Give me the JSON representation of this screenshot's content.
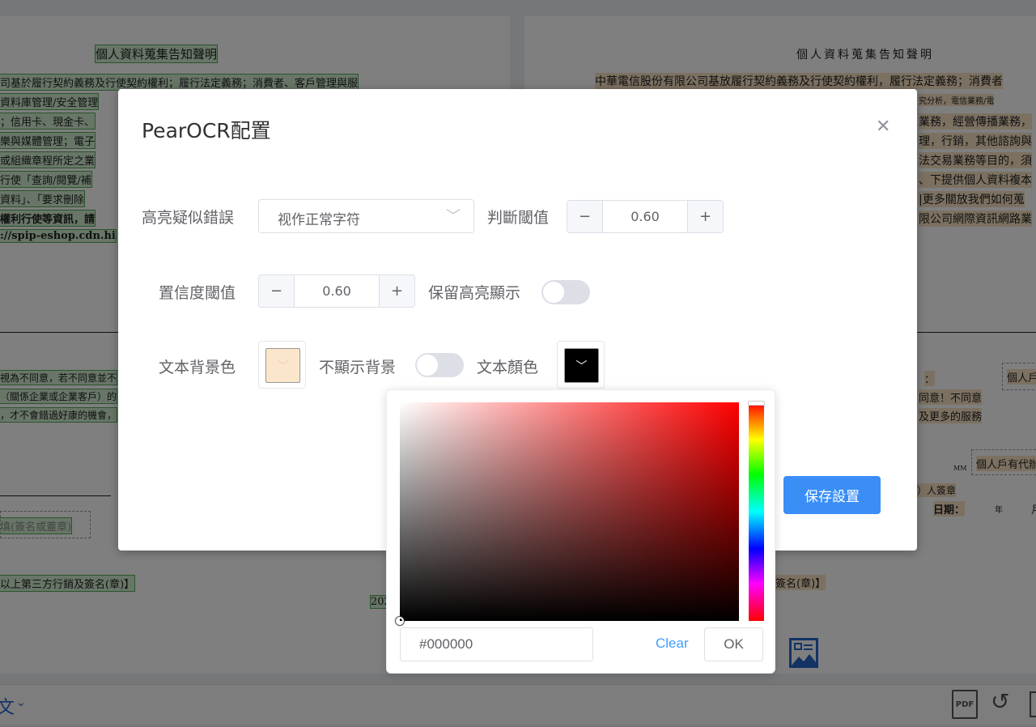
{
  "background": {
    "left_page": {
      "title": "個人資料蒐集告知聲明",
      "lines": [
        "司基於履行契約義務及行使契約權利；履行法定義務；消費者、客戶管理與服",
        "資料庫管理/安全管理",
        "；信用卡、現金卡、",
        "樂與媒體管理；電子",
        "或組織章程所定之業",
        "行使「查詢/閱覽/補",
        "資料」、「要求刪除",
        "權利行使等資訊，請",
        "://spip-eshop.cdn.hi"
      ],
      "lower_lines": [
        "視為不同意，若不同意並不",
        "（關係企業或企業客戶）的",
        "，才不會錯過好康的機會，"
      ],
      "sign_box": "填(簽名或蓋章)",
      "third_party": "以上第三方行銷及簽名(章)】",
      "year": "202"
    },
    "right_page": {
      "title": "個人資料蒐集告知聲明",
      "first_line": "中華電信股份有限公司基放履行契約義務及行使契約權利，履行法定義務；消費者",
      "fragments": [
        "究分析，電信業務/電",
        "業務，經營傳播業務，",
        "理，行銷，其他諮詢與",
        "法交易業務等目的，須",
        "、下提供個人資料複本",
        "|更多關放我們如何蒐",
        "限公司網際資訊網路業"
      ],
      "lower_fragments": [
        "：",
        "同意！不同意",
        "及更多的服務"
      ],
      "box1": "個人戶",
      "box2": "個人戶有代辦",
      "mm": "MM",
      "sign": "）人簽章",
      "date": "日期：",
      "year_label": "年",
      "month_label": "月",
      "sign2": "簽名(章)】"
    },
    "bottombar": {
      "lang": "文",
      "icons": [
        "pdf-icon",
        "rotate-icon",
        "trash-icon"
      ]
    }
  },
  "dialog": {
    "title": "PearOCR配置",
    "highlight_label": "高亮疑似錯誤",
    "highlight_value": "视作正常字符",
    "judge_label": "判斷閾值",
    "judge_value": "0.60",
    "confidence_label": "置信度閾值",
    "confidence_value": "0.60",
    "keep_highlight_label": "保留高亮顯示",
    "keep_highlight_on": false,
    "bg_color_label": "文本背景色",
    "bg_color": "#fbe6cc",
    "no_bg_label": "不顯示背景",
    "no_bg_on": false,
    "text_color_label": "文本顏色",
    "text_color": "#000000",
    "save_label": "保存設置",
    "minus": "−",
    "plus": "+"
  },
  "color_picker": {
    "hue": "#ff0000",
    "value": "#000000",
    "clear_label": "Clear",
    "ok_label": "OK"
  }
}
